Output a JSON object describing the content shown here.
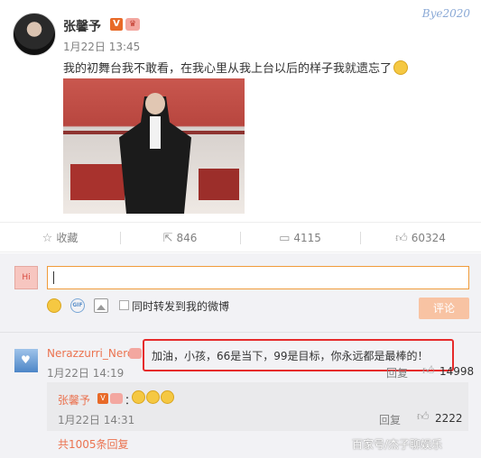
{
  "post": {
    "username": "张馨予",
    "verified_badge": "V",
    "time": "1月22日 13:45",
    "text": "我的初舞台我不敢看，在我心里从我上台以后的样子我就遗忘了",
    "watermark": "Bye2020"
  },
  "actions": {
    "favorite_label": "收藏",
    "repost_count": "846",
    "comment_count": "4115",
    "like_count": "60324"
  },
  "composer": {
    "input_value": "",
    "repost_checkbox_label": "同时转发到我的微博",
    "submit_label": "评论"
  },
  "comments": [
    {
      "username": "Nerazzurri_Nero",
      "text": "加油，小孩，66是当下，99是目标，你永远都是最棒的！",
      "time": "1月22日 14:19",
      "reply_label": "回复",
      "like_count": "14998",
      "replies": [
        {
          "username": "张馨予",
          "verified_badge": "V",
          "text": "：",
          "time": "1月22日 14:31",
          "reply_label": "回复",
          "like_count": "2222"
        }
      ]
    }
  ],
  "more_replies": "共1005条回复",
  "watermark_bottom": "百家号/杰子聊娱乐",
  "colors": {
    "accent_orange": "#eb7350",
    "highlight_red": "#e62b2b",
    "submit_disabled": "#f8c3a3"
  }
}
